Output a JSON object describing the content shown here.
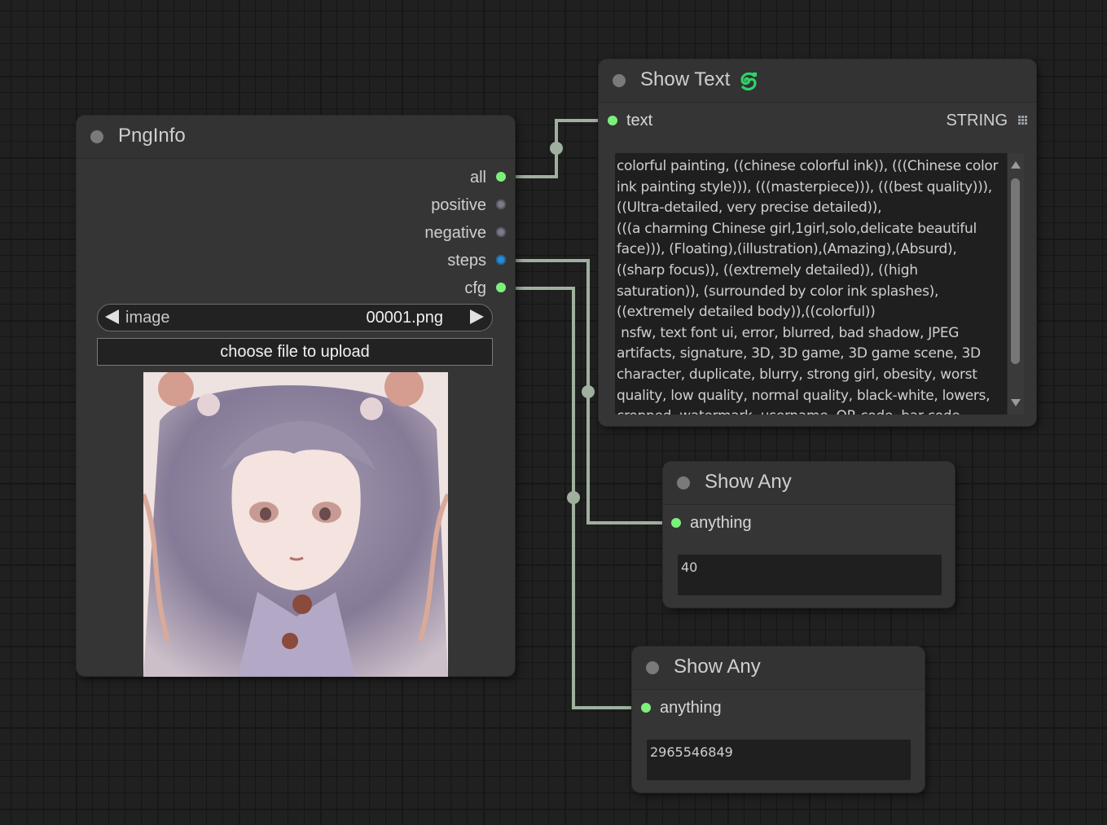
{
  "nodes": {
    "pnginfo": {
      "title": "PngInfo",
      "outputs": [
        {
          "label": "all",
          "color": "green"
        },
        {
          "label": "positive",
          "color": "grey"
        },
        {
          "label": "negative",
          "color": "grey"
        },
        {
          "label": "steps",
          "color": "blue"
        },
        {
          "label": "cfg",
          "color": "green"
        }
      ],
      "image_widget": {
        "label": "image",
        "value": "00001.png"
      },
      "upload_button_label": "choose file to upload"
    },
    "show_text": {
      "title": "Show Text",
      "input_label": "text",
      "type_label": "STRING",
      "text_value": "colorful painting, ((chinese colorful ink)), (((Chinese color ink painting style))), (((masterpiece))), (((best quality))),((Ultra-detailed, very precise detailed)),\n(((a charming Chinese girl,1girl,solo,delicate beautiful face))), (Floating),(illustration),(Amazing),(Absurd),((sharp focus)), ((extremely detailed)), ((high saturation)), (surrounded by color ink splashes),((extremely detailed body)),((colorful))\n nsfw, text font ui, error, blurred, bad shadow, JPEG artifacts, signature, 3D, 3D game, 3D game scene, 3D character, duplicate, blurry, strong girl, obesity, worst quality, low quality, normal quality, black-white, lowers, cropped, watermark, username, QR code, bar code, censored, mosaic, excrement, faeces, shit"
    },
    "show_any_1": {
      "title": "Show Any",
      "input_label": "anything",
      "value": "40"
    },
    "show_any_2": {
      "title": "Show Any",
      "input_label": "anything",
      "value": "2965546849"
    }
  },
  "colors": {
    "link": "#9fb09f",
    "slot_green": "#7cf07c",
    "slot_blue": "#2d8bd2",
    "slot_grey": "#7c7a86",
    "node_bg": "#353535",
    "canvas_bg": "#202020",
    "custom_icon": "#2fd36a"
  },
  "icons": {
    "show_text_badge": "custom-node-snake-icon",
    "type_grid": "grid-icon",
    "combo_left": "triangle-left-icon",
    "combo_right": "triangle-right-icon"
  }
}
